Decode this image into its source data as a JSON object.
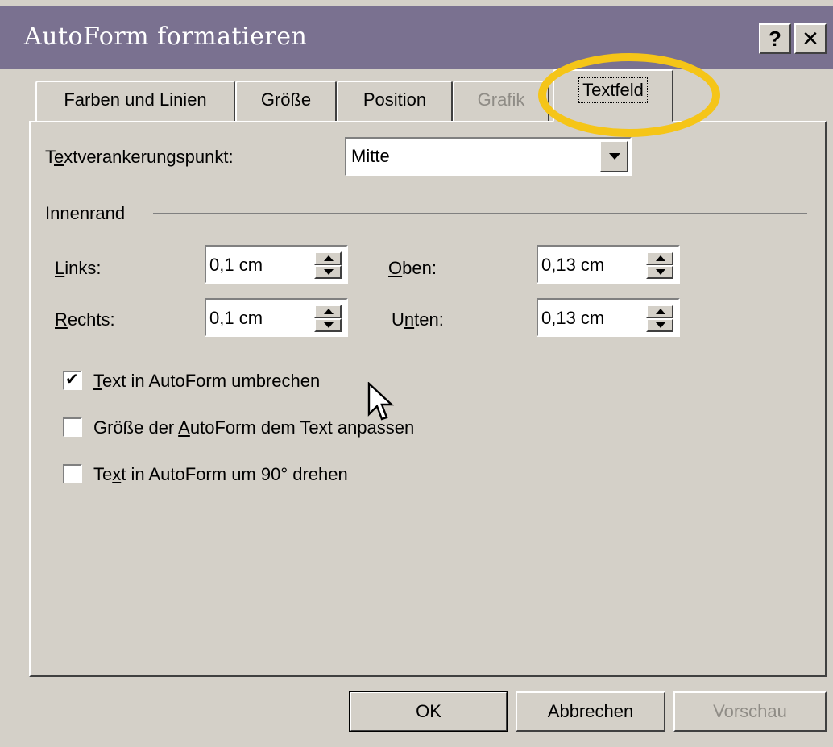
{
  "window": {
    "title": "AutoForm formatieren",
    "help_label": "?",
    "close_label": "✕"
  },
  "tabs": [
    {
      "label": "Farben und Linien",
      "state": "normal"
    },
    {
      "label": "Größe",
      "state": "normal"
    },
    {
      "label": "Position",
      "state": "normal"
    },
    {
      "label": "Grafik",
      "state": "disabled"
    },
    {
      "label": "Textfeld",
      "state": "active"
    }
  ],
  "anchor": {
    "label_pre": "T",
    "label_key": "e",
    "label_post": "xtverankerungspunkt:",
    "value": "Mitte"
  },
  "margins": {
    "group_label": "Innenrand",
    "left": {
      "key": "L",
      "rest": "inks:",
      "value": "0,1 cm"
    },
    "right": {
      "key": "R",
      "rest": "echts:",
      "value": "0,1 cm"
    },
    "top": {
      "key": "O",
      "rest": "ben:",
      "value": "0,13 cm"
    },
    "bottom": {
      "pre": "U",
      "key": "n",
      "rest": "ten:",
      "value": "0,13 cm"
    }
  },
  "options": {
    "wrap": {
      "pre": "",
      "key": "T",
      "post": "ext in AutoForm umbrechen",
      "checked": true,
      "mark": "✔"
    },
    "resize": {
      "pre": "Größe der ",
      "key": "A",
      "post": "utoForm dem Text anpassen",
      "checked": false
    },
    "rotate": {
      "pre": "Te",
      "key": "x",
      "post": "t in AutoForm um 90° drehen",
      "checked": false
    }
  },
  "buttons": {
    "ok": "OK",
    "cancel": "Abbrechen",
    "preview": "Vorschau"
  },
  "colors": {
    "titlebar": "#7a7190",
    "face": "#d4d0c8",
    "highlight_ring": "#f5c518",
    "disabled_text": "#8f8c86"
  }
}
